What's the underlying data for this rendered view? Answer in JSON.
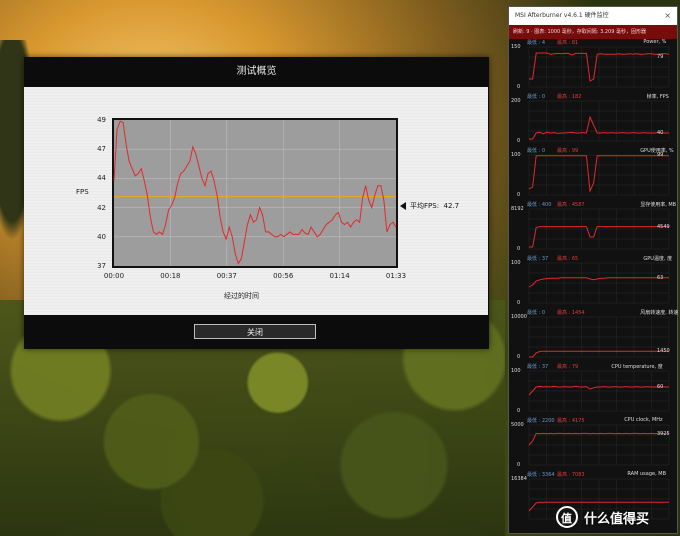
{
  "dialog": {
    "title": "测试概览",
    "close_label": "关闭"
  },
  "chart_data": {
    "type": "line",
    "ylabel": "FPS",
    "xlabel": "经过的时间",
    "yticks": [
      "49",
      "47",
      "44",
      "42",
      "40",
      "37"
    ],
    "xticks": [
      "00:00",
      "00:18",
      "00:37",
      "00:56",
      "01:14",
      "01:33"
    ],
    "ylim": [
      37,
      49
    ],
    "xlim_seconds": [
      0,
      93
    ],
    "avg_label": "平均FPS:",
    "avg_value": "42.7",
    "avg_numeric": 42.7,
    "series": [
      {
        "color": "#e22a2a",
        "x": [
          0,
          1,
          2,
          3,
          4,
          5,
          6,
          7,
          8,
          9,
          10,
          11,
          12,
          13,
          14,
          15,
          16,
          17,
          18,
          19,
          20,
          21,
          22,
          23,
          24,
          25,
          26,
          27,
          28,
          29,
          30,
          31,
          32,
          33,
          34,
          35,
          36,
          37,
          38,
          39,
          40,
          41,
          42,
          43,
          44,
          45,
          46,
          47,
          48,
          49,
          50,
          51,
          52,
          53,
          54,
          55,
          56,
          57,
          58,
          59,
          60,
          61,
          62,
          63,
          64,
          65,
          66,
          67,
          68,
          69,
          70,
          71,
          72,
          73,
          74,
          75,
          76,
          77,
          78,
          79,
          80,
          81,
          82,
          83,
          84,
          85,
          86,
          87,
          88,
          89,
          90,
          91,
          92,
          93
        ],
        "y": [
          44,
          48.2,
          48.9,
          48.8,
          47,
          45.6,
          45,
          44.4,
          44.6,
          45,
          44,
          42.8,
          41,
          39.8,
          39.6,
          39.8,
          39.6,
          40.4,
          41.6,
          42,
          42.6,
          43.8,
          44.6,
          44.8,
          45.2,
          45.6,
          46.8,
          46.2,
          45.2,
          44.2,
          43.6,
          44.6,
          44.8,
          44,
          42.8,
          41,
          39.8,
          39.2,
          40.2,
          39.4,
          38,
          37.2,
          37.6,
          39,
          40.4,
          41.2,
          40.6,
          40.8,
          41.8,
          41.2,
          39.8,
          39.8,
          39.6,
          39.4,
          39.4,
          39.6,
          39.4,
          39.6,
          39.8,
          39.6,
          39.6,
          39.6,
          40,
          39.7,
          39.6,
          40.2,
          39.8,
          39.4,
          39.6,
          40,
          40.4,
          40.6,
          40.8,
          41.2,
          41.4,
          40.6,
          40.4,
          40.6,
          40.2,
          40.6,
          40.8,
          40.6,
          42.6,
          43.6,
          42.4,
          41.8,
          42.8,
          43.6,
          43.6,
          42.4,
          39.8,
          40.4,
          40.6,
          40.2
        ]
      }
    ]
  },
  "afterburner": {
    "title": "MSI Afterburner v4.6.1 硬件监控",
    "close_glyph": "×",
    "status": "刷新: 9  ·  图表: 1000  毫秒，存取间隔: 3.209  毫秒，固形器",
    "graphs": [
      {
        "name": "Power, %",
        "top": "150",
        "bottom": "0",
        "min": "最低 : 4",
        "max": "最高 : 81",
        "value": "79",
        "value_y": 0.75,
        "points": [
          0.2,
          0.2,
          0.85,
          0.85,
          0.85,
          0.85,
          0.82,
          0.83,
          0.84,
          0.83,
          0.84,
          0.84,
          0.8,
          0.84,
          0.84,
          0.84,
          0.84,
          0.15,
          0.2,
          0.82,
          0.83,
          0.82,
          0.82,
          0.82,
          0.82,
          0.83,
          0.82,
          0.82,
          0.83,
          0.82,
          0.83,
          0.82,
          0.82,
          0.83,
          0.83,
          0.82,
          0.82,
          0.83,
          0.83,
          0.82
        ]
      },
      {
        "name": "帧率, FPS",
        "top": "200",
        "bottom": "0",
        "min": "最低 : 0",
        "max": "最高 : 182",
        "value": "40",
        "value_y": 0.2,
        "points": [
          0.05,
          0.05,
          0.2,
          0.22,
          0.18,
          0.22,
          0.2,
          0.21,
          0.19,
          0.2,
          0.2,
          0.21,
          0.22,
          0.2,
          0.2,
          0.21,
          0.2,
          0.6,
          0.4,
          0.2,
          0.2,
          0.21,
          0.2,
          0.21,
          0.2,
          0.2,
          0.21,
          0.2,
          0.2,
          0.21,
          0.2,
          0.2,
          0.21,
          0.2,
          0.2,
          0.2,
          0.21,
          0.2,
          0.2,
          0.2
        ]
      },
      {
        "name": "GPU使用率, %",
        "top": "100",
        "bottom": "0",
        "min": "最低 : 0",
        "max": "最高 : 99",
        "value": "99",
        "value_y": 0.99,
        "points": [
          0.15,
          0.2,
          0.98,
          0.98,
          0.98,
          0.98,
          0.98,
          0.98,
          0.98,
          0.98,
          0.98,
          0.98,
          0.98,
          0.98,
          0.98,
          0.98,
          0.98,
          0.1,
          0.3,
          0.98,
          0.98,
          0.98,
          0.98,
          0.98,
          0.98,
          0.98,
          0.98,
          0.98,
          0.98,
          0.98,
          0.98,
          0.98,
          0.98,
          0.98,
          0.98,
          0.98,
          0.98,
          0.98,
          0.98,
          0.98
        ]
      },
      {
        "name": "显存使用率, MB",
        "top": "8192",
        "bottom": "0",
        "min": "最低 : 400",
        "max": "最高 : 4587",
        "value": "4549",
        "value_y": 0.56,
        "points": [
          0.05,
          0.05,
          0.54,
          0.56,
          0.56,
          0.56,
          0.56,
          0.56,
          0.56,
          0.56,
          0.56,
          0.56,
          0.56,
          0.56,
          0.56,
          0.56,
          0.56,
          0.3,
          0.3,
          0.56,
          0.56,
          0.56,
          0.56,
          0.56,
          0.56,
          0.56,
          0.56,
          0.56,
          0.56,
          0.56,
          0.56,
          0.56,
          0.56,
          0.56,
          0.56,
          0.56,
          0.56,
          0.56,
          0.56,
          0.56
        ]
      },
      {
        "name": "GPU温度, 度",
        "top": "100",
        "bottom": "0",
        "min": "最低 : 37",
        "max": "最高 : 65",
        "value": "63",
        "value_y": 0.63,
        "points": [
          0.4,
          0.45,
          0.55,
          0.58,
          0.6,
          0.61,
          0.62,
          0.62,
          0.62,
          0.63,
          0.63,
          0.63,
          0.63,
          0.63,
          0.63,
          0.63,
          0.63,
          0.6,
          0.58,
          0.6,
          0.62,
          0.62,
          0.63,
          0.63,
          0.63,
          0.63,
          0.63,
          0.63,
          0.63,
          0.63,
          0.63,
          0.63,
          0.63,
          0.63,
          0.63,
          0.63,
          0.63,
          0.63,
          0.63,
          0.63
        ]
      },
      {
        "name": "风扇转速度, 转速",
        "top": "10000",
        "bottom": "0",
        "min": "最低 : 0",
        "max": "最高 : 1454",
        "value": "1450",
        "value_y": 0.145,
        "points": [
          0.0,
          0.0,
          0.1,
          0.14,
          0.145,
          0.145,
          0.145,
          0.145,
          0.145,
          0.145,
          0.145,
          0.145,
          0.145,
          0.145,
          0.145,
          0.145,
          0.145,
          0.145,
          0.145,
          0.145,
          0.145,
          0.145,
          0.145,
          0.145,
          0.145,
          0.145,
          0.145,
          0.145,
          0.145,
          0.145,
          0.145,
          0.145,
          0.145,
          0.145,
          0.145,
          0.145,
          0.145,
          0.145,
          0.145,
          0.145
        ]
      },
      {
        "name": "CPU temperature, 度",
        "top": "100",
        "bottom": "0",
        "min": "最低 : 37",
        "max": "最高 : 79",
        "value": "60",
        "value_y": 0.6,
        "points": [
          0.4,
          0.5,
          0.6,
          0.62,
          0.6,
          0.61,
          0.6,
          0.62,
          0.6,
          0.6,
          0.61,
          0.6,
          0.6,
          0.62,
          0.6,
          0.6,
          0.61,
          0.55,
          0.58,
          0.6,
          0.6,
          0.61,
          0.6,
          0.6,
          0.61,
          0.6,
          0.6,
          0.61,
          0.6,
          0.6,
          0.61,
          0.6,
          0.6,
          0.61,
          0.6,
          0.6,
          0.6,
          0.61,
          0.6,
          0.6
        ]
      },
      {
        "name": "CPU clock, MHz",
        "top": "5000",
        "bottom": "0",
        "min": "最低 : 2200",
        "max": "最高 : 4175",
        "value": "3925",
        "value_y": 0.785,
        "points": [
          0.5,
          0.6,
          0.79,
          0.78,
          0.79,
          0.78,
          0.79,
          0.78,
          0.79,
          0.79,
          0.78,
          0.79,
          0.78,
          0.79,
          0.78,
          0.79,
          0.79,
          0.78,
          0.79,
          0.78,
          0.79,
          0.78,
          0.79,
          0.79,
          0.78,
          0.79,
          0.78,
          0.79,
          0.78,
          0.79,
          0.79,
          0.78,
          0.79,
          0.78,
          0.79,
          0.78,
          0.79,
          0.79,
          0.78,
          0.79
        ]
      },
      {
        "name": "RAM usage, MB",
        "top": "16384",
        "bottom": "",
        "min": "最低 : 3364",
        "max": "最高 : 7083",
        "value": "",
        "value_y": 0.4,
        "points": [
          0.2,
          0.3,
          0.4,
          0.42,
          0.42,
          0.42,
          0.42,
          0.42,
          0.42,
          0.42,
          0.42,
          0.42,
          0.42,
          0.42,
          0.42,
          0.42,
          0.42,
          0.42,
          0.42,
          0.42,
          0.42,
          0.42,
          0.42,
          0.42,
          0.42,
          0.42,
          0.42,
          0.42,
          0.42,
          0.42,
          0.42,
          0.42,
          0.42,
          0.42,
          0.42,
          0.42,
          0.42,
          0.42,
          0.42,
          0.42
        ]
      }
    ]
  },
  "watermark": {
    "badge": "值",
    "text": "什么值得买"
  }
}
